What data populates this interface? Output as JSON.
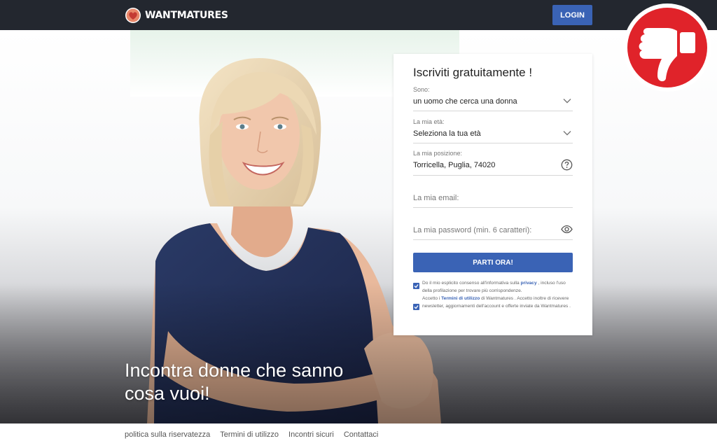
{
  "header": {
    "logo_text": "WANTMATURES",
    "logo_icon": "heart-icon",
    "login_label": "LOGIN"
  },
  "hero": {
    "headline": "Incontra donne che sanno cosa vuoi!"
  },
  "form": {
    "title": "Iscriviti gratuitamente !",
    "sono": {
      "label": "Sono:",
      "value": "un uomo che cerca una donna"
    },
    "eta": {
      "label": "La mia età:",
      "value": "Seleziona la tua età"
    },
    "posizione": {
      "label": "La mia posizione:",
      "value": "Torricella, Puglia, 74020"
    },
    "email": {
      "placeholder": "La mia email:"
    },
    "password": {
      "placeholder": "La mia password (min. 6 caratteri):"
    },
    "submit_label": "PARTI ORA!",
    "consent1": {
      "text_before": "Do il mio esplicito consenso all'informativa sulla ",
      "link": "privacy",
      "text_after": " , incluso l'uso della profilazione per trovare più corrispondenze."
    },
    "consent2": {
      "text_before": "Accetto i ",
      "link": "Termini di utilizzo",
      "text_after": " di Wantmatures . Accetto inoltre di ricevere newsletter, aggiornamenti dell'account e offerte inviate da Wantmatures ."
    }
  },
  "footer": {
    "links": [
      "politica sulla riservatezza",
      "Termini di utilizzo",
      "Incontri sicuri",
      "Contattaci"
    ]
  },
  "colors": {
    "header_bg": "#23272f",
    "accent": "#3a63b5",
    "badge_red": "#e0232a"
  }
}
